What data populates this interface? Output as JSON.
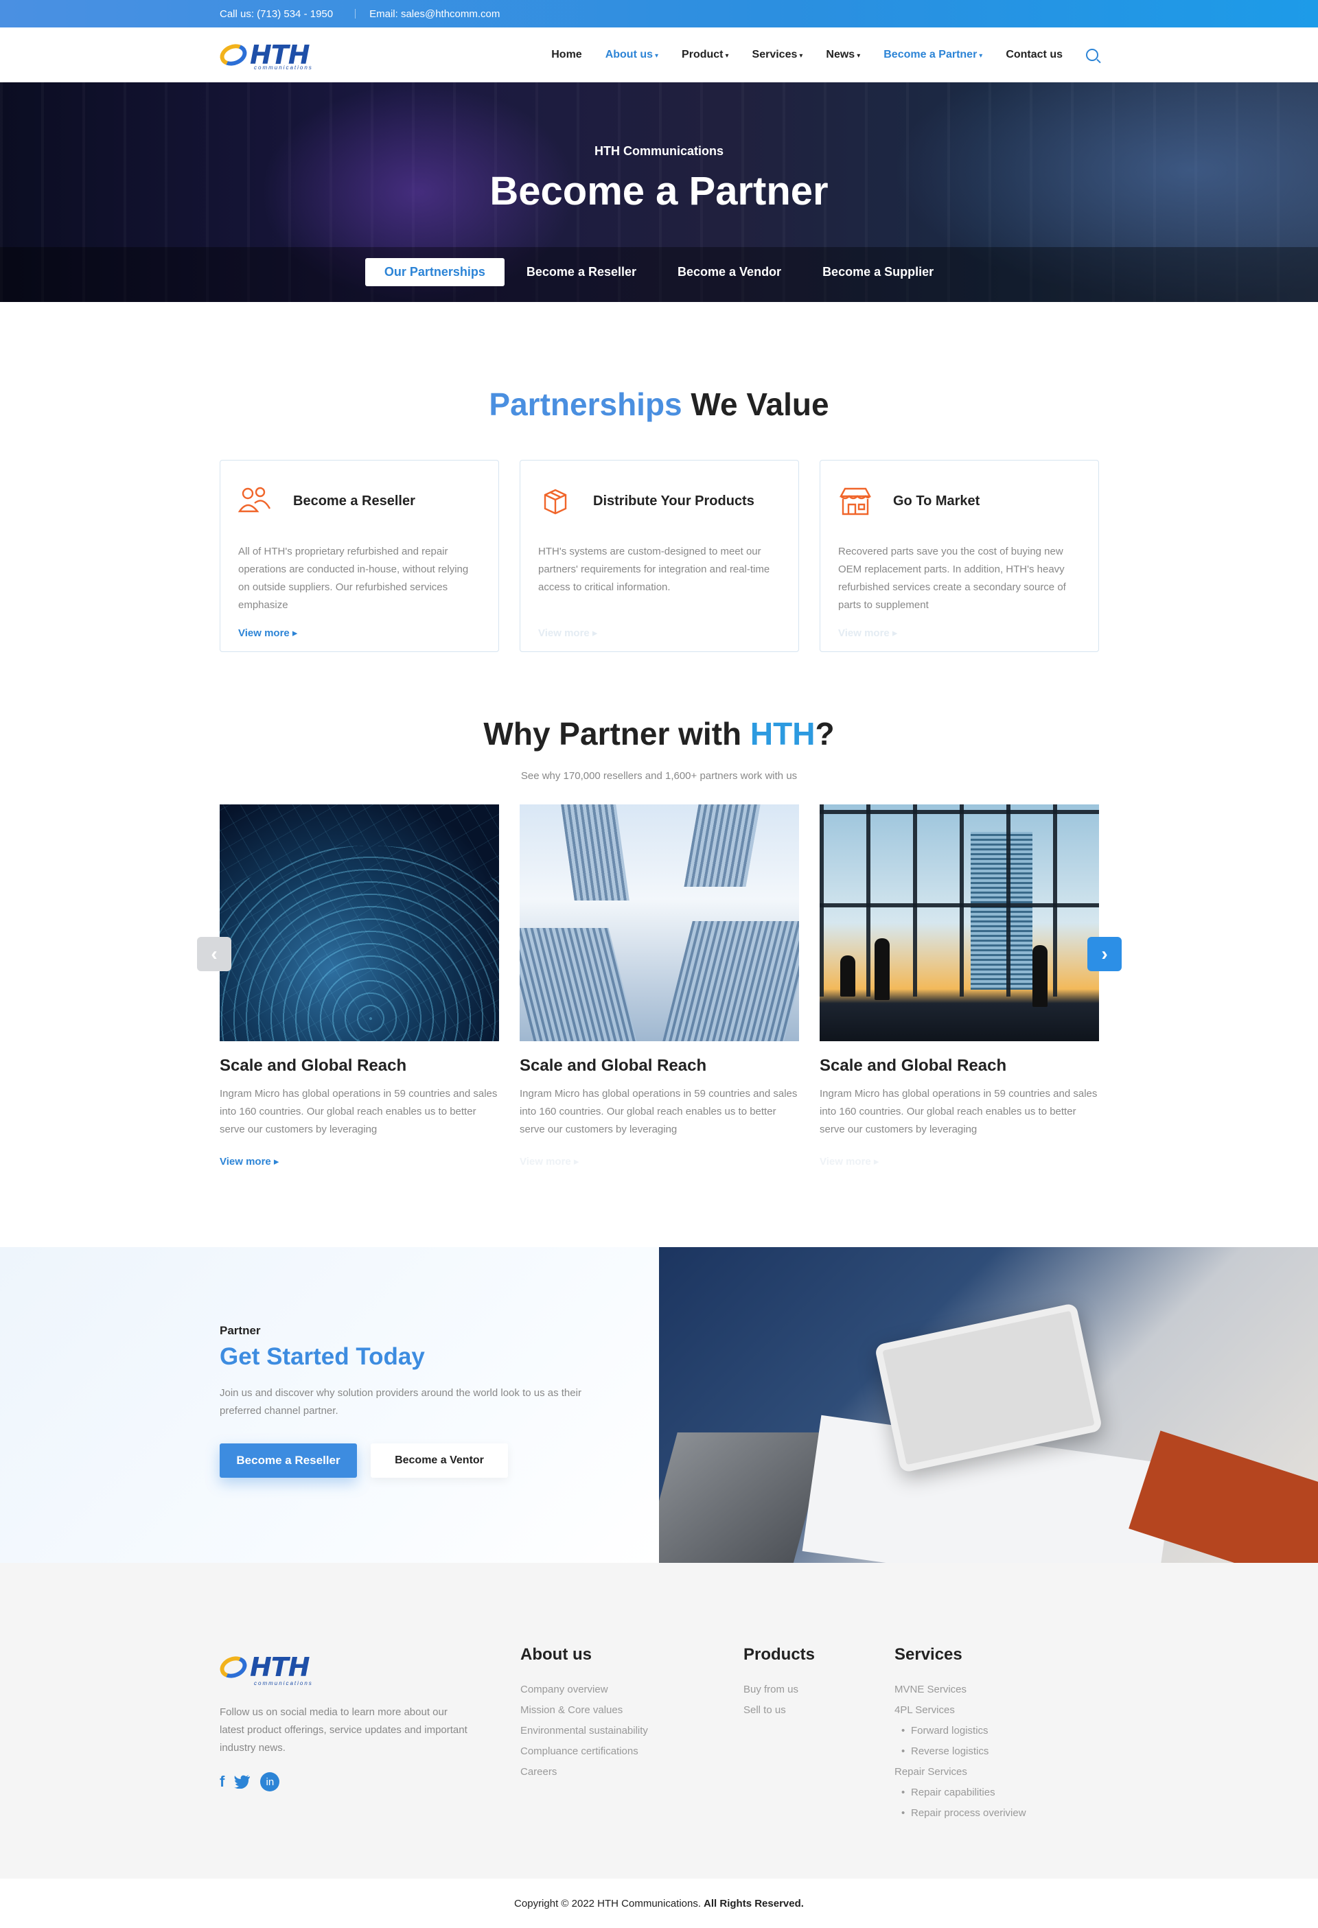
{
  "topbar": {
    "phone": "Call us: (713) 534 - 1950",
    "email": "Email: sales@hthcomm.com"
  },
  "brand": {
    "name": "HTH",
    "sub": "communications"
  },
  "nav": [
    {
      "label": "Home",
      "caret": ""
    },
    {
      "label": "About us",
      "caret": "▾"
    },
    {
      "label": "Product",
      "caret": "▾"
    },
    {
      "label": "Services",
      "caret": "▾"
    },
    {
      "label": "News",
      "caret": "▾"
    },
    {
      "label": "Become a Partner",
      "caret": "▾"
    },
    {
      "label": "Contact us",
      "caret": ""
    }
  ],
  "hero": {
    "eyebrow": "HTH Communications",
    "title": "Become a Partner",
    "tabs": [
      "Our Partnerships",
      "Become a Reseller",
      "Become a Vendor",
      "Become a Supplier"
    ]
  },
  "partnerships": {
    "title_blue": "Partnerships",
    "title_rest": " We Value",
    "cards": [
      {
        "title": "Become a Reseller",
        "text": "All of HTH's proprietary refurbished and repair operations are conducted in-house, without relying on outside suppliers. Our refurbished services emphasize",
        "more": "View more"
      },
      {
        "title": "Distribute Your Products",
        "text": "HTH's systems are custom-designed to meet our partners' requirements for integration and real-time access to critical information.",
        "more": "View more"
      },
      {
        "title": "Go To Market",
        "text": "Recovered parts save you the cost of buying new OEM replacement parts. In addition, HTH's heavy refurbished services create a secondary source of parts to supplement",
        "more": "View more"
      }
    ]
  },
  "why": {
    "title_start": "Why Partner with ",
    "title_blue": "HTH",
    "title_end": "?",
    "subtitle": "See why 170,000 resellers and 1,600+ partners work with us",
    "slides": [
      {
        "title": "Scale and Global Reach",
        "text": "Ingram Micro has global operations in 59 countries and sales into 160 countries. Our global reach enables us to better serve our customers by leveraging",
        "more": "View more"
      },
      {
        "title": "Scale and Global Reach",
        "text": "Ingram Micro has global operations in 59 countries and sales into 160 countries. Our global reach enables us to better serve our customers by leveraging",
        "more": "View more"
      },
      {
        "title": "Scale and Global Reach",
        "text": "Ingram Micro has global operations in 59 countries and sales into 160 countries. Our global reach enables us to better serve our customers by leveraging",
        "more": "View more"
      }
    ],
    "prev": "‹",
    "next": "›"
  },
  "get_started": {
    "label": "Partner",
    "title": "Get Started Today",
    "text": "Join us and discover why solution providers around the world look to us as their preferred channel partner.",
    "btn_primary": "Become a Reseller",
    "btn_secondary": "Become a Ventor"
  },
  "footer": {
    "desc": "Follow us on social media to learn more about our latest product offerings, service updates and important industry news.",
    "social": {
      "facebook": "f",
      "linkedin": "in"
    },
    "about": {
      "title": "About us",
      "items": [
        "Company overview",
        "Mission & Core values",
        "Environmental sustainability",
        "Compluance certifications",
        "Careers"
      ]
    },
    "products": {
      "title": "Products",
      "items": [
        "Buy from us",
        "Sell to us"
      ]
    },
    "services": {
      "title": "Services",
      "items": [
        {
          "label": "MVNE Services",
          "sub": false
        },
        {
          "label": "4PL Services",
          "sub": false
        },
        {
          "label": "Forward logistics",
          "sub": true
        },
        {
          "label": "Reverse logistics",
          "sub": true
        },
        {
          "label": "Repair Services",
          "sub": false
        },
        {
          "label": "Repair capabilities",
          "sub": true
        },
        {
          "label": "Repair process overiview",
          "sub": true
        }
      ]
    },
    "copyright": "Copyright © 2022 HTH Communications.",
    "rights": "All Rights Reserved."
  },
  "colors": {
    "accent": "#2c84d6",
    "title_blue": "#4a8fe0",
    "icon_orange": "#f0652a"
  }
}
